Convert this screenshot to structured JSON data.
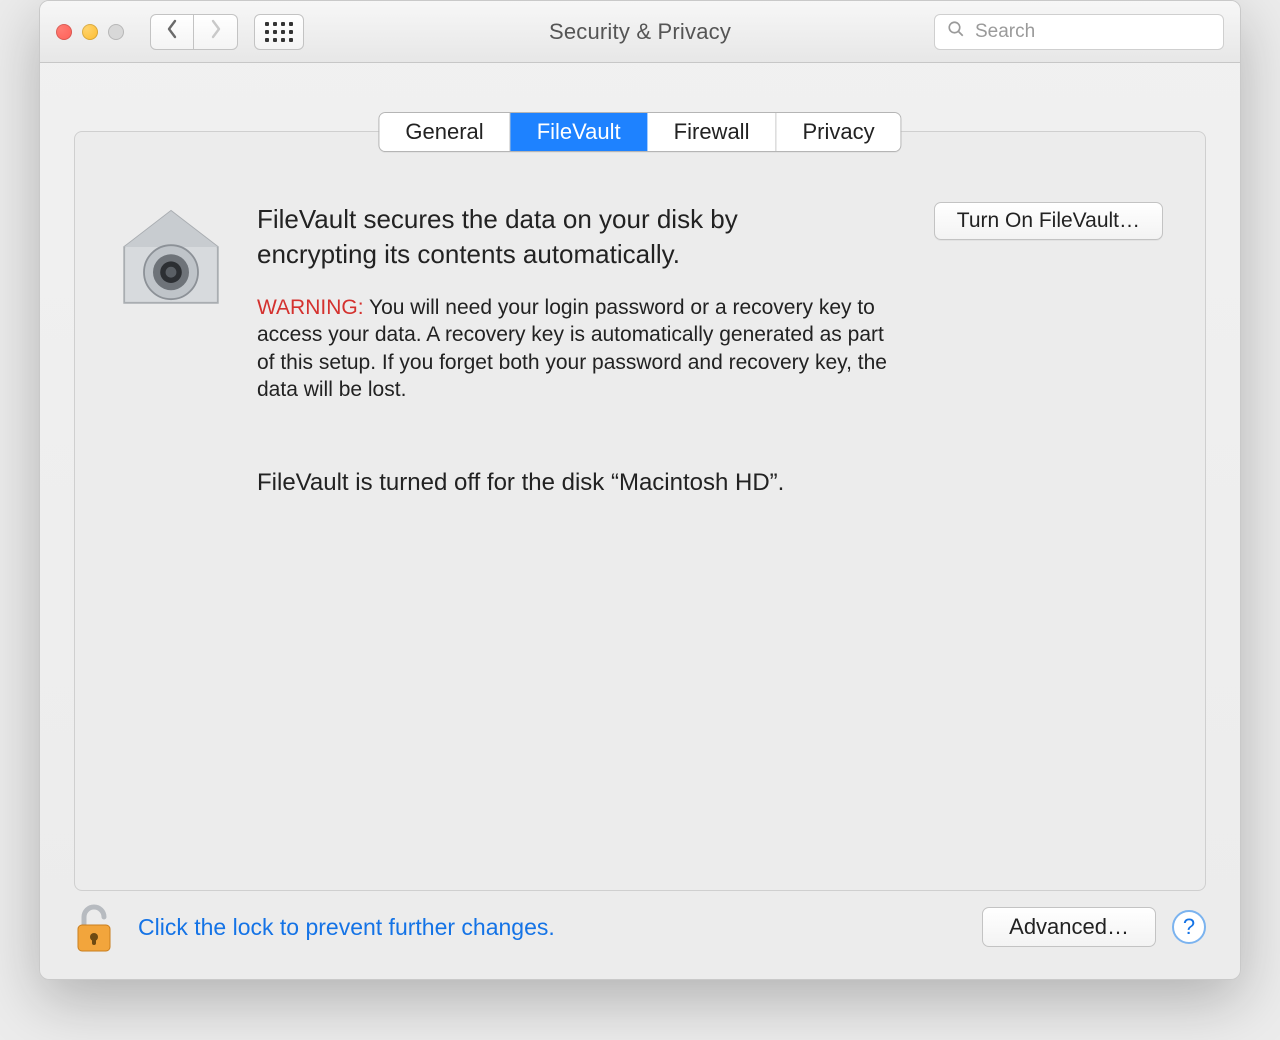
{
  "window": {
    "title": "Security & Privacy"
  },
  "search": {
    "placeholder": "Search",
    "value": ""
  },
  "tabs": [
    {
      "label": "General"
    },
    {
      "label": "FileVault"
    },
    {
      "label": "Firewall"
    },
    {
      "label": "Privacy"
    }
  ],
  "active_tab_index": 1,
  "content": {
    "headline": "FileVault secures the data on your disk by encrypting its contents automatically.",
    "turn_on_label": "Turn On FileVault…",
    "warning_label": "WARNING:",
    "warning_text": " You will need your login password or a recovery key to access your data. A recovery key is automatically generated as part of this setup. If you forget both your password and recovery key, the data will be lost.",
    "status": "FileVault is turned off for the disk “Macintosh HD”."
  },
  "footer": {
    "lock_text": "Click the lock to prevent further changes.",
    "advanced_label": "Advanced…",
    "help_label": "?"
  }
}
